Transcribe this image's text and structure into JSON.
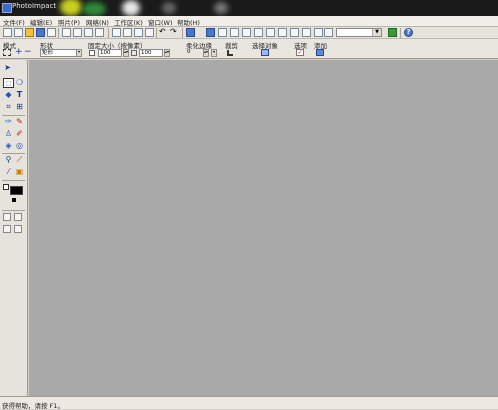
{
  "window": {
    "title": "PhotoImpact"
  },
  "menu": [
    "文件(F)",
    "编辑(E)",
    "照片(P)",
    "网络(N)",
    "工作区(K)",
    "窗口(W)",
    "帮助(H)"
  ],
  "options": {
    "mode_label": "模式",
    "shape_label": "形状",
    "shape_value": "矩形",
    "fixed_size_label": "固定大小（按像素）",
    "width_value": "100",
    "height_value": "100",
    "soft_edge_label": "柔化边缘",
    "soft_edge_value": "0",
    "crop_label": "裁剪",
    "select_object_label": "选择对象",
    "options_label": "选项",
    "add_label": "添加"
  },
  "status": {
    "text": "获得帮助，请按 F1。"
  },
  "colors": {
    "workspace": "#a9a9a9",
    "chrome": "#d4d0c8",
    "titlebar": "#1a1a1a"
  }
}
